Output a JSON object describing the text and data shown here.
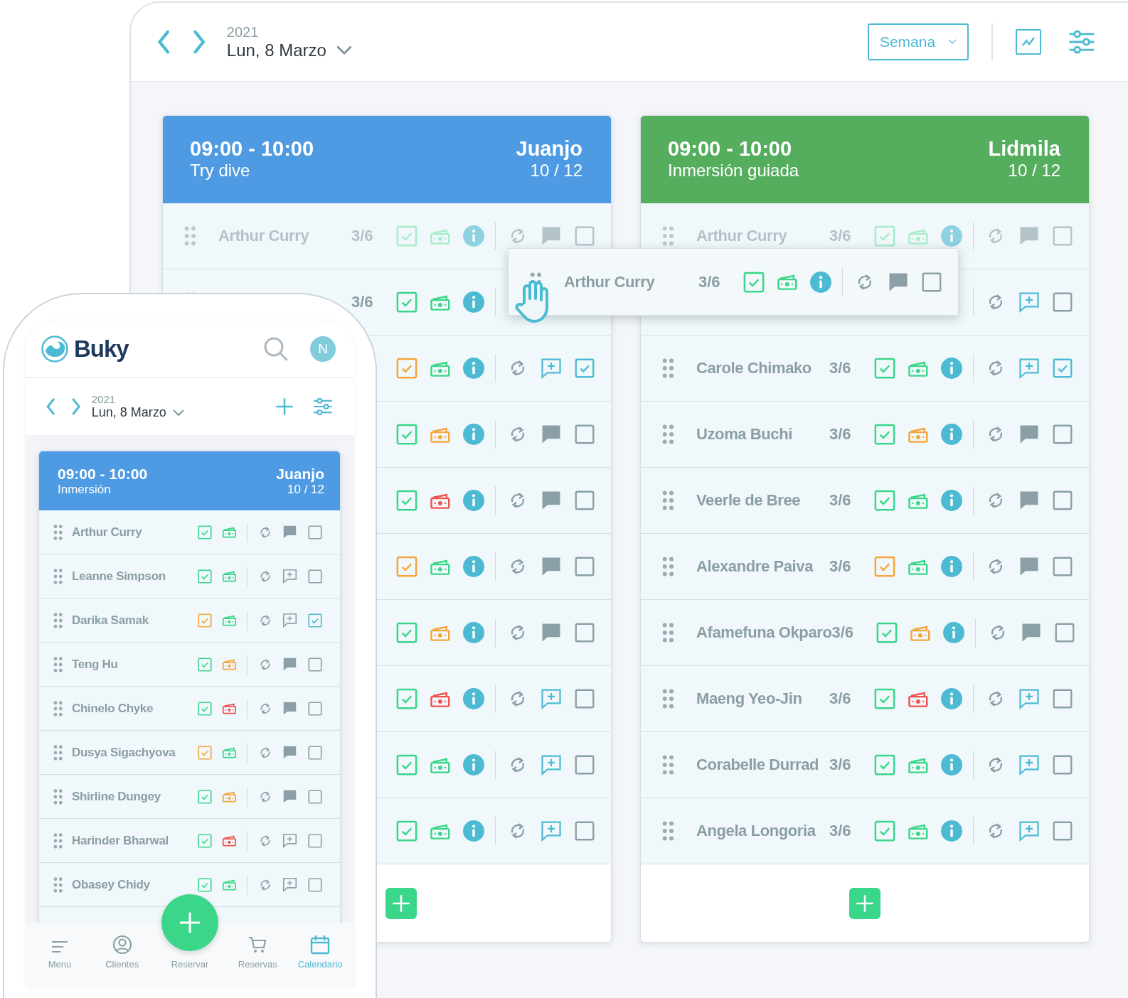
{
  "desktop": {
    "year": "2021",
    "date": "Lun, 8 Marzo",
    "view": "Semana",
    "columns": [
      {
        "time": "09:00 - 10:00",
        "activity": "Try dive",
        "guide": "Juanjo",
        "capacity": "10 / 12",
        "color": "#4e9be3",
        "rows": [
          {
            "name": "Arthur Curry",
            "count": "3/6",
            "check": {
              "color": "#a8ecca"
            },
            "cash": {
              "color": "#a8ecca"
            },
            "commented": true,
            "selected": false,
            "faded": true
          },
          {
            "count": "3/6",
            "check": {
              "color": "#3ad68a"
            },
            "cash": {
              "color": "#3ad68a"
            },
            "faded": false
          },
          {
            "check": {
              "color": "#f5a53a"
            },
            "cash": {
              "color": "#3ad68a"
            },
            "commented": false,
            "selected": true,
            "faded": false
          },
          {
            "check": {
              "color": "#3ad68a"
            },
            "cash": {
              "color": "#f5a53a"
            },
            "commented": true,
            "selected": false,
            "faded": false
          },
          {
            "check": {
              "color": "#3ad68a"
            },
            "cash": {
              "color": "#ef5350"
            },
            "commented": true,
            "selected": false,
            "faded": false
          },
          {
            "check": {
              "color": "#f5a53a"
            },
            "cash": {
              "color": "#3ad68a"
            },
            "commented": true,
            "selected": false,
            "faded": false
          },
          {
            "check": {
              "color": "#3ad68a"
            },
            "cash": {
              "color": "#f5a53a"
            },
            "commented": true,
            "selected": false,
            "faded": false
          },
          {
            "check": {
              "color": "#3ad68a"
            },
            "cash": {
              "color": "#ef5350"
            },
            "commented": false,
            "selected": false,
            "faded": false
          },
          {
            "check": {
              "color": "#3ad68a"
            },
            "cash": {
              "color": "#3ad68a"
            },
            "commented": false,
            "selected": false,
            "faded": false
          },
          {
            "check": {
              "color": "#3ad68a"
            },
            "cash": {
              "color": "#3ad68a"
            },
            "commented": false,
            "selected": false,
            "faded": false
          }
        ]
      },
      {
        "time": "09:00 - 10:00",
        "activity": "Inmersión guiada",
        "guide": "Lidmila",
        "capacity": "10 / 12",
        "color": "#55ad5e",
        "rows": [
          {
            "name": "Arthur Curry",
            "count": "3/6",
            "check": {
              "color": "#a8ecca"
            },
            "cash": {
              "color": "#a8ecca"
            },
            "commented": true,
            "selected": false,
            "faded": true
          },
          {
            "commented": false,
            "selected": false,
            "faded": false
          },
          {
            "name": "Carole Chimako",
            "count": "3/6",
            "check": {
              "color": "#3ad68a"
            },
            "cash": {
              "color": "#3ad68a"
            },
            "commented": false,
            "selected": true,
            "faded": false
          },
          {
            "name": "Uzoma Buchi",
            "count": "3/6",
            "check": {
              "color": "#3ad68a"
            },
            "cash": {
              "color": "#f5a53a"
            },
            "commented": true,
            "selected": false,
            "faded": false
          },
          {
            "name": "Veerle de Bree",
            "count": "3/6",
            "check": {
              "color": "#3ad68a"
            },
            "cash": {
              "color": "#3ad68a"
            },
            "commented": true,
            "selected": false,
            "faded": false
          },
          {
            "name": "Alexandre Paiva",
            "count": "3/6",
            "check": {
              "color": "#f5a53a"
            },
            "cash": {
              "color": "#3ad68a"
            },
            "commented": true,
            "selected": false,
            "faded": false
          },
          {
            "name": "Afamefuna Okparo",
            "count": "3/6",
            "check": {
              "color": "#3ad68a"
            },
            "cash": {
              "color": "#f5a53a"
            },
            "commented": true,
            "selected": false,
            "faded": false
          },
          {
            "name": "Maeng Yeo-Jin",
            "count": "3/6",
            "check": {
              "color": "#3ad68a"
            },
            "cash": {
              "color": "#ef5350"
            },
            "commented": false,
            "selected": false,
            "faded": false
          },
          {
            "name": "Corabelle Durrad",
            "count": "3/6",
            "check": {
              "color": "#3ad68a"
            },
            "cash": {
              "color": "#3ad68a"
            },
            "commented": false,
            "selected": false,
            "faded": false
          },
          {
            "name": "Angela Longoria",
            "count": "3/6",
            "check": {
              "color": "#3ad68a"
            },
            "cash": {
              "color": "#3ad68a"
            },
            "commented": false,
            "selected": false,
            "faded": false
          }
        ]
      }
    ]
  },
  "drag_row": {
    "name": "Arthur Curry",
    "count": "3/6",
    "check": {
      "color": "#3ad68a"
    },
    "cash": {
      "color": "#3ad68a"
    },
    "commented": true,
    "selected": false,
    "faded": false
  },
  "phone": {
    "brand": "Buky",
    "avatar": "N",
    "year": "2021",
    "date": "Lun, 8 Marzo",
    "card": {
      "time": "09:00 - 10:00",
      "activity": "Inmersión",
      "guide": "Juanjo",
      "capacity": "10 / 12",
      "color": "#4e9be3",
      "rows": [
        {
          "name": "Arthur Curry",
          "check": {
            "color": "#3ad68a"
          },
          "cash": {
            "color": "#3ad68a"
          },
          "commented": true,
          "selected": false,
          "faded": false
        },
        {
          "name": "Leanne Simpson",
          "check": {
            "color": "#3ad68a"
          },
          "cash": {
            "color": "#3ad68a"
          },
          "commented": false,
          "selected": false,
          "faded": false
        },
        {
          "name": "Darika Samak",
          "check": {
            "color": "#f5a53a"
          },
          "cash": {
            "color": "#3ad68a"
          },
          "commented": false,
          "selected": true,
          "faded": false
        },
        {
          "name": "Teng Hu",
          "check": {
            "color": "#3ad68a"
          },
          "cash": {
            "color": "#f5a53a"
          },
          "commented": true,
          "selected": false,
          "faded": false
        },
        {
          "name": "Chinelo Chyke",
          "check": {
            "color": "#3ad68a"
          },
          "cash": {
            "color": "#ef5350"
          },
          "commented": true,
          "selected": false,
          "faded": false
        },
        {
          "name": "Dusya Sigachyova",
          "check": {
            "color": "#f5a53a"
          },
          "cash": {
            "color": "#3ad68a"
          },
          "commented": true,
          "selected": false,
          "faded": false
        },
        {
          "name": "Shirline Dungey",
          "check": {
            "color": "#3ad68a"
          },
          "cash": {
            "color": "#f5a53a"
          },
          "commented": true,
          "selected": false,
          "faded": false
        },
        {
          "name": "Harinder Bharwal",
          "check": {
            "color": "#3ad68a"
          },
          "cash": {
            "color": "#ef5350"
          },
          "commented": false,
          "selected": false,
          "faded": false
        },
        {
          "name": "Obasey Chidy",
          "check": {
            "color": "#3ad68a"
          },
          "cash": {
            "color": "#3ad68a"
          },
          "commented": false,
          "selected": false,
          "faded": false
        }
      ]
    },
    "nav": [
      {
        "label": "Menu",
        "selected": false
      },
      {
        "label": "Clientes",
        "selected": false
      },
      {
        "label": "Reservar",
        "selected": false
      },
      {
        "label": "Reservas",
        "selected": false
      },
      {
        "label": "Calendario",
        "selected": true
      }
    ]
  }
}
